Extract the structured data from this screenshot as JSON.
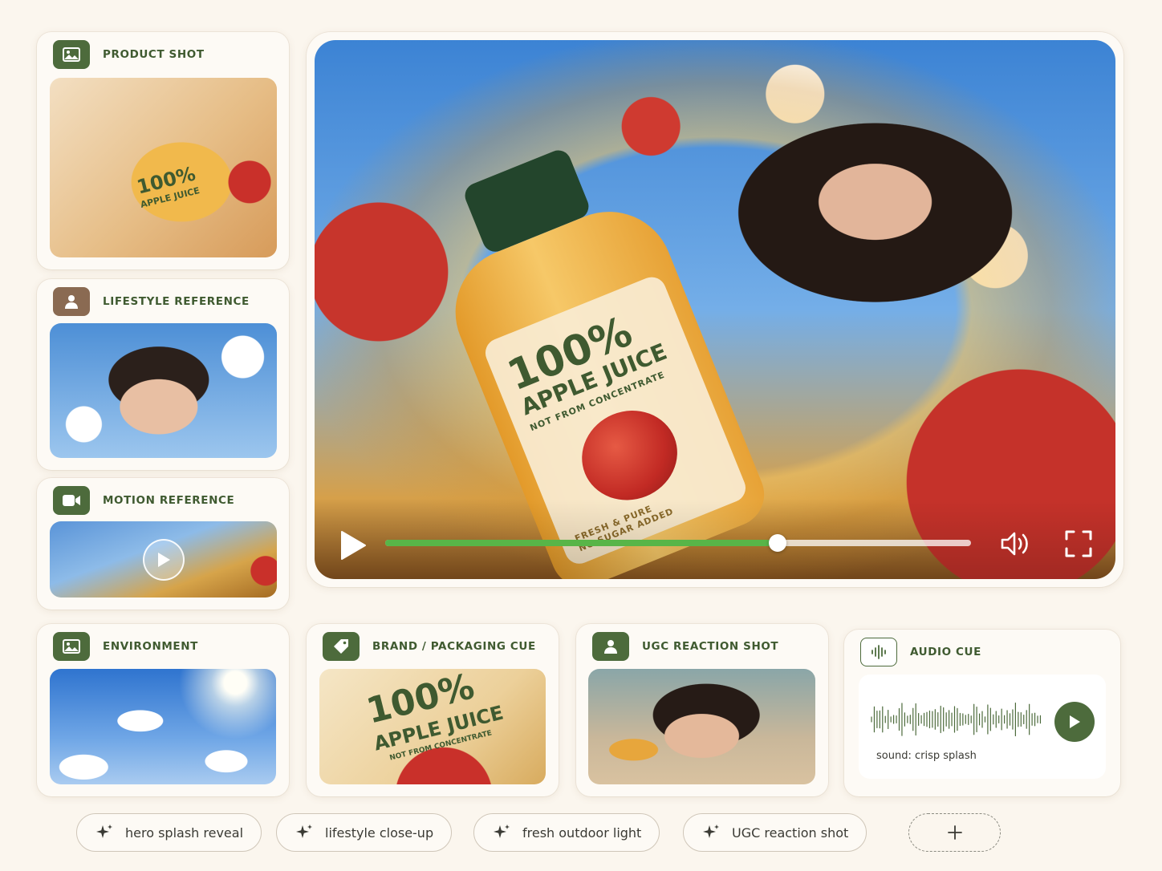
{
  "sidebar": {
    "product_shot": {
      "title": "PRODUCT SHOT",
      "thumb_text_big": "100%",
      "thumb_text_small": "APPLE JUICE"
    },
    "lifestyle_reference": {
      "title": "LIFESTYLE REFERENCE"
    },
    "motion_reference": {
      "title": "MOTION REFERENCE"
    }
  },
  "player": {
    "label_big": "100%",
    "label_mid": "APPLE JUICE",
    "label_small": "NOT FROM CONCENTRATE",
    "label_foot_1": "FRESH & PURE",
    "label_foot_2": "NO SUGAR ADDED",
    "progress": 0.67
  },
  "cards": {
    "environment": {
      "title": "ENVIRONMENT"
    },
    "brand": {
      "title": "BRAND / PACKAGING CUE",
      "thumb_big": "100%",
      "thumb_mid": "APPLE JUICE",
      "thumb_small": "NOT FROM CONCENTRATE"
    },
    "ugc": {
      "title": "UGC REACTION SHOT"
    },
    "audio": {
      "title": "AUDIO CUE",
      "caption": "sound: crisp splash"
    }
  },
  "chips": [
    {
      "label": "hero splash reveal"
    },
    {
      "label": "lifestyle close-up"
    },
    {
      "label": "fresh outdoor light"
    },
    {
      "label": "UGC reaction shot"
    }
  ],
  "icons": {
    "image": "image-icon",
    "person": "person-icon",
    "video": "video-camera-icon",
    "tag": "tag-icon",
    "audio": "waveform-icon",
    "sparkle": "sparkle-icon",
    "add": "plus-icon"
  },
  "colors": {
    "accent": "#4d6b3c",
    "progress": "#58b548",
    "background": "#fbf6ee"
  }
}
